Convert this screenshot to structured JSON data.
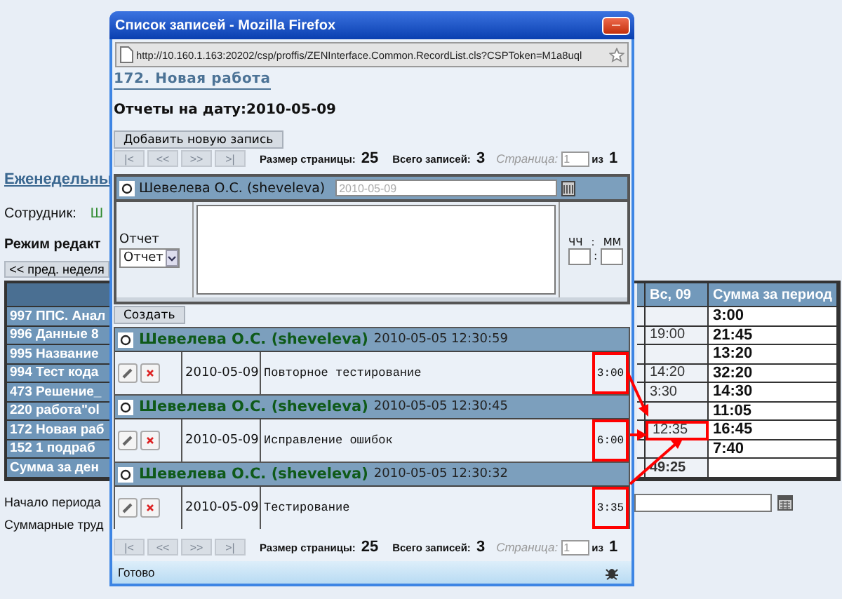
{
  "page": {
    "week_link": "Еженедельны",
    "employee_label": "Сотрудник:",
    "employee_value": "Ш",
    "mode_label": "Режим редакт",
    "prev_week_button": "<< пред. неделя",
    "table": {
      "columns": [
        "Вс, 09",
        "Сумма за период"
      ],
      "rows": [
        {
          "name": "997 ППС. Анал",
          "total": "3:00",
          "sunday_highlighted": false
        },
        {
          "name": "996 Данные 8",
          "sunday": "19:00",
          "total": "21:45",
          "sunday_highlighted": false
        },
        {
          "name": "995 Название",
          "total": "13:20",
          "sunday_highlighted": false
        },
        {
          "name": "994 Тест кода",
          "sunday": "14:20",
          "total": "32:20",
          "sunday_highlighted": false
        },
        {
          "name": "473 Решение_",
          "sunday": "3:30",
          "total": "14:30",
          "sunday_highlighted": false
        },
        {
          "name": "220 работа\"ol",
          "total": "11:05",
          "sunday_highlighted": false
        },
        {
          "name": "172 Новая раб",
          "sunday": "12:35",
          "total": "16:45",
          "sunday_highlighted": true
        },
        {
          "name": "152 1 подраб",
          "total": "7:40",
          "sunday_highlighted": false
        },
        {
          "name": "Сумма за ден",
          "sunday": "49:25",
          "sunday_highlighted": false
        }
      ]
    },
    "period_start_label": "Начало периода",
    "total_label": "Суммарные труд"
  },
  "popup": {
    "title": "Список записей - Mozilla Firefox",
    "url": "http://10.160.1.163:20202/csp/proffis/ZENInterface.Common.RecordList.cls?CSPToken=M1a8uql",
    "heading_link": "172. Новая работа",
    "date_heading": "Отчеты на дату:2010-05-09",
    "add_button": "Добавить новую запись",
    "pagers": [
      {
        "buttons": [
          {
            "label": "|<",
            "disabled": true
          },
          {
            "label": "<<",
            "disabled": true
          },
          {
            "label": ">>",
            "disabled": true
          },
          {
            "label": ">|",
            "disabled": true
          }
        ],
        "page_size_label": "Размер страницы:",
        "page_size": "25",
        "total_label": "Всего записей:",
        "total": "3",
        "page_label": "Страница:",
        "page": "1",
        "of_label": "из",
        "pages": "1"
      },
      {
        "buttons": [
          {
            "label": "|<",
            "disabled": true
          },
          {
            "label": "<<",
            "disabled": true
          },
          {
            "label": ">>",
            "disabled": true
          },
          {
            "label": ">|",
            "disabled": true
          }
        ],
        "page_size_label": "Размер страницы:",
        "page_size": "25",
        "total_label": "Всего записей:",
        "total": "3",
        "page_label": "Страница:",
        "page": "1",
        "of_label": "из",
        "pages": "1"
      }
    ],
    "form": {
      "checked": false,
      "user": "Шевелева О.С. (sheveleva)",
      "date_placeholder": "2010-05-09",
      "type_label": "Отчет",
      "type_value": "Отчет",
      "hours_label": "ЧЧ",
      "label_separator": ":",
      "minutes_label": "ММ",
      "field_separator": ":",
      "create_button": "Создать"
    },
    "records": [
      {
        "checked": false,
        "user": "Шевелева О.С. (sheveleva)",
        "timestamp": "2010-05-05 12:30:59",
        "date": "2010-05-09",
        "description": "Повторное тестирование",
        "hours": "3:00",
        "highlighted": true
      },
      {
        "checked": false,
        "user": "Шевелева О.С. (sheveleva)",
        "timestamp": "2010-05-05 12:30:45",
        "date": "2010-05-09",
        "description": "Исправление ошибок",
        "hours": "6:00",
        "highlighted": true
      },
      {
        "checked": false,
        "user": "Шевелева О.С. (sheveleva)",
        "timestamp": "2010-05-05 12:30:32",
        "date": "2010-05-09",
        "description": "Тестирование",
        "hours": "3:35",
        "highlighted": true
      }
    ],
    "status": "Готово"
  }
}
